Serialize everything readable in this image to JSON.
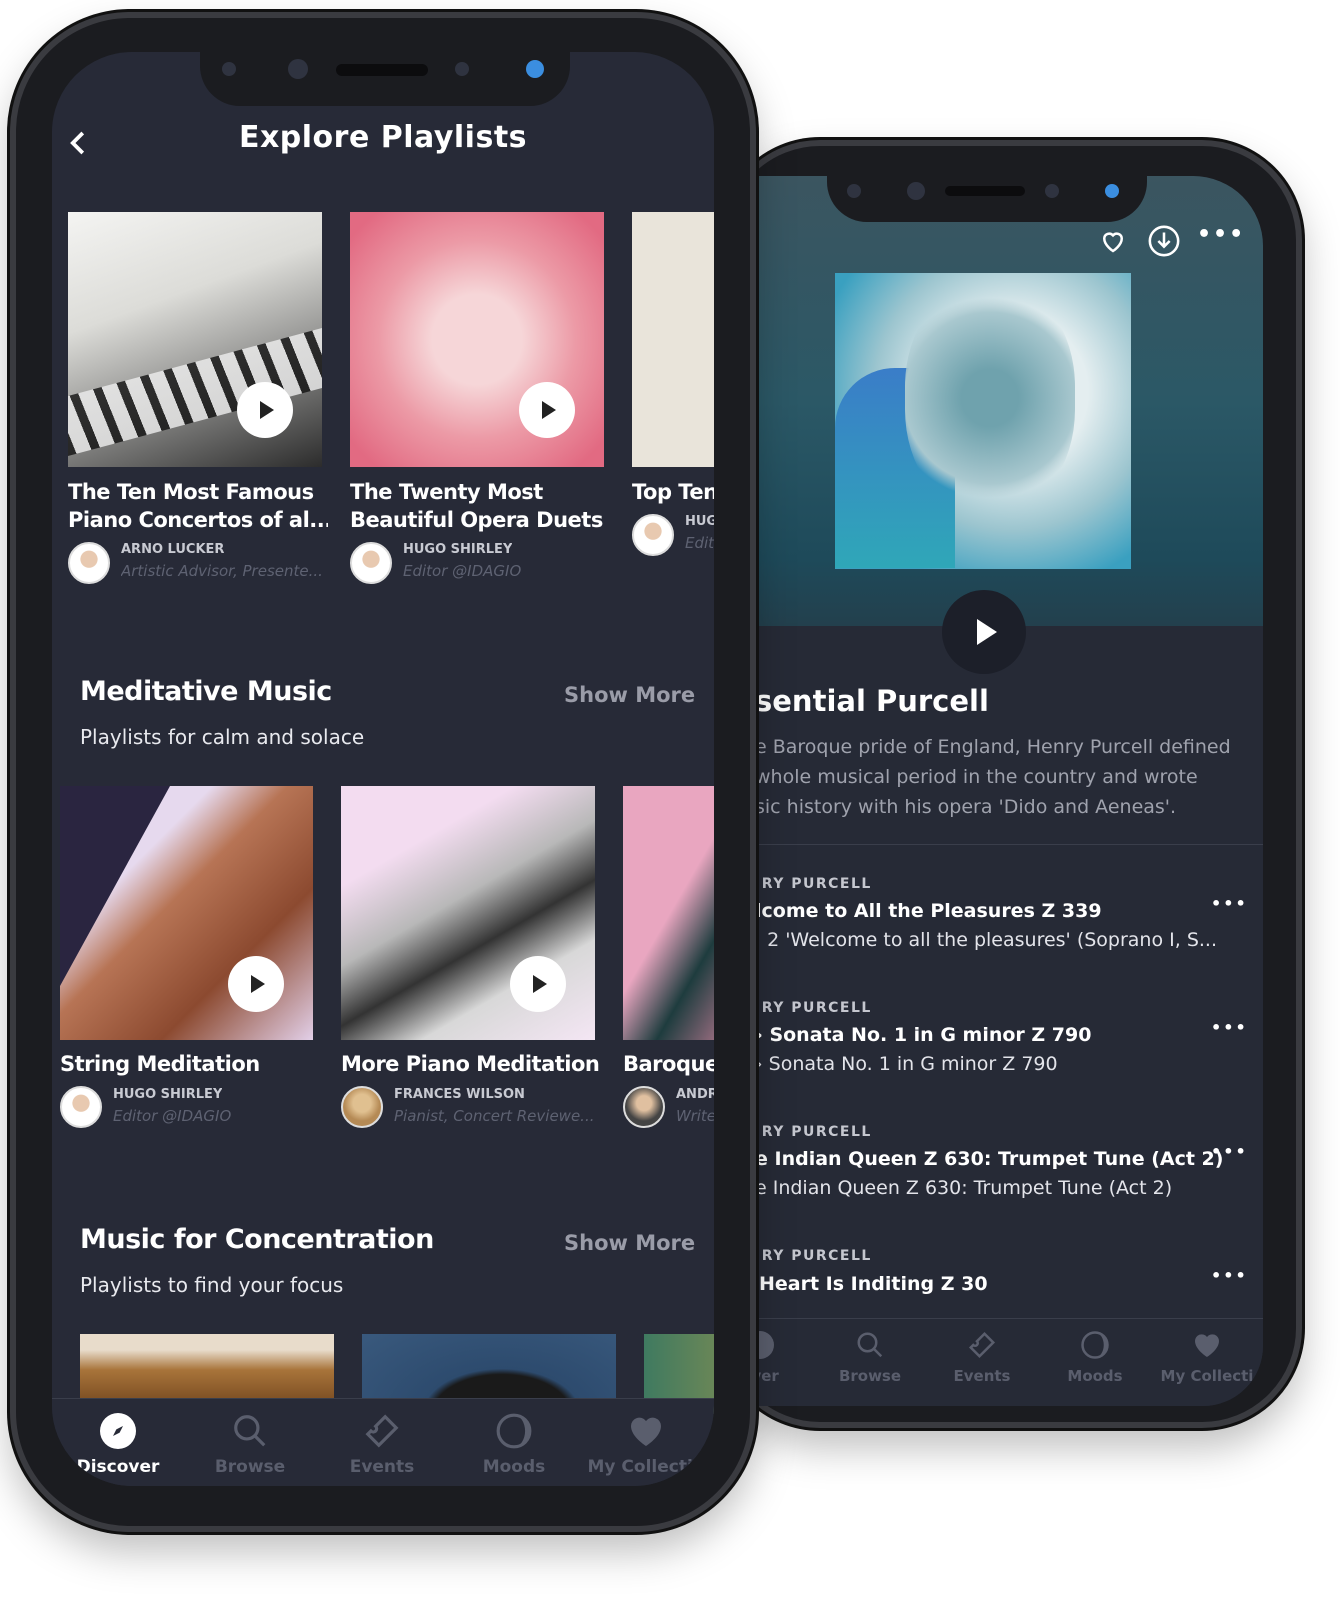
{
  "front": {
    "header": {
      "title": "Explore Playlists",
      "back_icon": "chevron-left-icon"
    },
    "featured": [
      {
        "title1": "The Ten Most Famous",
        "title2": "Piano Concertos of al...",
        "author": "ARNO LÜCKER",
        "role": "Artistic Advisor, Presente..."
      },
      {
        "title1": "The Twenty Most",
        "title2": "Beautiful Opera Duets",
        "author": "HUGO SHIRLEY",
        "role": "Editor @IDAGIO"
      },
      {
        "title1": "Top Ten",
        "title2": "",
        "author": "HUG",
        "role": "Edit"
      }
    ],
    "sections": [
      {
        "title": "Meditative Music",
        "subtitle": "Playlists for calm and solace",
        "show_more": "Show More",
        "items": [
          {
            "title": "String Meditation",
            "author": "HUGO SHIRLEY",
            "role": "Editor @IDAGIO"
          },
          {
            "title": "More Piano Meditation",
            "author": "FRANCES WILSON",
            "role": "Pianist, Concert Reviewe..."
          },
          {
            "title": "Baroque",
            "author": "ANDR",
            "role": "Write"
          }
        ]
      },
      {
        "title": "Music for Concentration",
        "subtitle": "Playlists to find your focus",
        "show_more": "Show More"
      }
    ],
    "tabs": [
      {
        "label": "Discover",
        "icon": "compass-icon",
        "active": true
      },
      {
        "label": "Browse",
        "icon": "search-icon"
      },
      {
        "label": "Events",
        "icon": "ticket-icon"
      },
      {
        "label": "Moods",
        "icon": "moon-icon"
      },
      {
        "label": "My Collectio",
        "icon": "heart-icon"
      }
    ]
  },
  "back": {
    "actions": [
      "heart-icon",
      "download-icon",
      "more-icon"
    ],
    "title": "sential Purcell",
    "description": [
      "e Baroque pride of England, Henry Purcell defined",
      "whole musical period in the country and wrote",
      "sic history with his opera 'Dido and Aeneas'."
    ],
    "tracks": [
      {
        "composer": "IRY PURCELL",
        "title": "lcome to All the Pleasures Z 339",
        "subtitle": ". 2 'Welcome to all the pleasures'  (Soprano I, S..."
      },
      {
        "composer": "IRY PURCELL",
        "title": "› Sonata No. 1 in G minor Z 790",
        "subtitle": "› Sonata No. 1 in G minor Z 790"
      },
      {
        "composer": "IRY PURCELL",
        "title": "e Indian Queen Z 630: Trumpet Tune (Act 2)",
        "subtitle": "e Indian Queen Z 630: Trumpet Tune (Act 2)"
      },
      {
        "composer": "IRY PURCELL",
        "title": "Heart Is Inditing Z 30",
        "subtitle": ""
      }
    ],
    "tabs": [
      {
        "label": "over",
        "icon": "compass-icon"
      },
      {
        "label": "Browse",
        "icon": "search-icon"
      },
      {
        "label": "Events",
        "icon": "ticket-icon"
      },
      {
        "label": "Moods",
        "icon": "moon-icon"
      },
      {
        "label": "My Collecti",
        "icon": "heart-icon"
      }
    ]
  },
  "colors": {
    "screen_bg": "#272a37",
    "accent_dot": "#3b8ee0",
    "muted": "#5a5e6d"
  }
}
